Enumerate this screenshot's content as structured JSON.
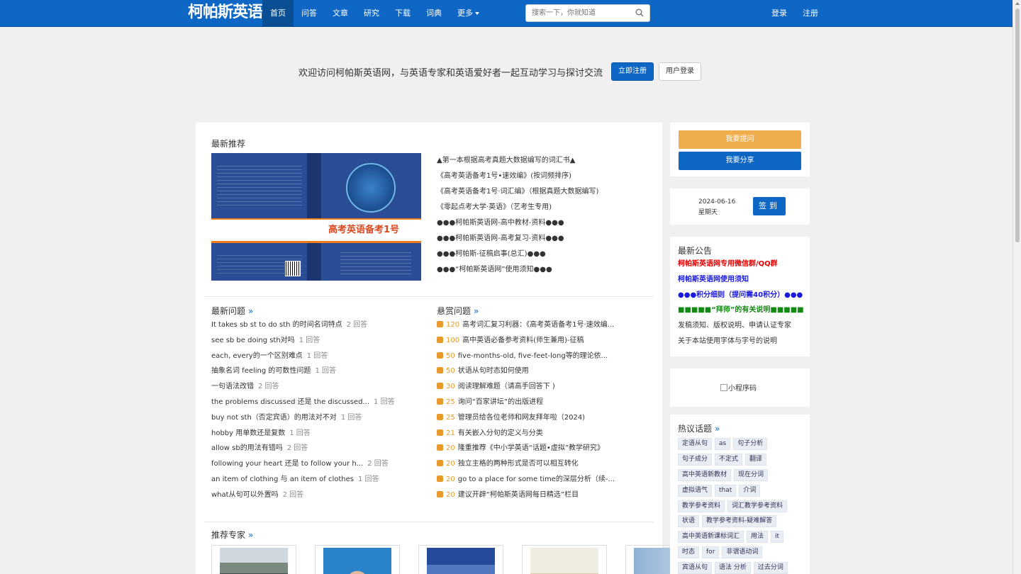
{
  "nav": {
    "brand": "柯帕斯英语网",
    "items": [
      "首页",
      "问答",
      "文章",
      "研究",
      "下载",
      "词典",
      "更多"
    ],
    "search_placeholder": "搜索一下，你就知道",
    "login": "登录",
    "register": "注册"
  },
  "welcome": {
    "text": "欢迎访问柯帕斯英语网，与英语专家和英语爱好者一起互动学习与探讨交流",
    "register_btn": "立即注册",
    "login_btn": "用户登录"
  },
  "recommend": {
    "title": "最新推荐",
    "book_title": "高考英语备考1号",
    "items": [
      "▲第一本根据高考真题大数据编写的词汇书▲",
      "《高考英语备考1号•速效编》(按词频排序)",
      "《高考英语备考1号·词汇编》（根据真题大数据编写)",
      "《零起点考大学·英语》（艺考生专用)",
      "●●●柯帕斯英语网-高中教材-资料●●●",
      "●●●柯帕斯英语网-高考复习-资料●●●",
      "●●●柯帕斯-征稿启事(总汇)●●●",
      "●●●“柯帕斯英语网”使用须知●●●"
    ]
  },
  "latest_questions": {
    "title": "最新问题",
    "more": "»",
    "items": [
      {
        "q": "It takes sb st to do sth 的时间名词特点",
        "a": "2 回答"
      },
      {
        "q": "see sb be doing sth对吗",
        "a": "1 回答"
      },
      {
        "q": "each, every的一个区别难点",
        "a": "1 回答"
      },
      {
        "q": "抽象名词 feeling 的可数性问题",
        "a": "1 回答"
      },
      {
        "q": "一句语法改错",
        "a": "2 回答"
      },
      {
        "q": "the problems discussed 还是 the discussed...",
        "a": "1 回答"
      },
      {
        "q": "buy not sth（否定宾语）的用法对不对",
        "a": "1 回答"
      },
      {
        "q": "hobby 用单数还是复数",
        "a": "1 回答"
      },
      {
        "q": "allow sb的用法有错吗",
        "a": "2 回答"
      },
      {
        "q": "following your heart 还是 to follow your h...",
        "a": "2 回答"
      },
      {
        "q": "an item of clothing 与 an item of clothes",
        "a": "1 回答"
      },
      {
        "q": "what从句可以外置吗",
        "a": "2 回答"
      }
    ]
  },
  "reward_questions": {
    "title": "悬赏问题",
    "more": "»",
    "items": [
      {
        "r": "120",
        "q": "高考词汇复习利器：《高考英语备考1号·速效编..."
      },
      {
        "r": "100",
        "q": "高中英语必备参考资料(师生兼用)-征稿"
      },
      {
        "r": "50",
        "q": "five-months-old, five-feet-long等的理论依..."
      },
      {
        "r": "50",
        "q": "状语从句时态如何使用"
      },
      {
        "r": "30",
        "q": "阅读理解难题（请高手回答下 )"
      },
      {
        "r": "25",
        "q": "询问“百家讲坛”的出版进程"
      },
      {
        "r": "25",
        "q": "管理员给各位老师和网友拜年啦（2024)"
      },
      {
        "r": "21",
        "q": "有关嵌入分句的定义与分类"
      },
      {
        "r": "20",
        "q": "隆重推荐《中小学英语“话题•虚拟”教学研究》"
      },
      {
        "r": "20",
        "q": "独立主格的两种形式是否可以相互转化"
      },
      {
        "r": "20",
        "q": "go to a place for some time的深层分析（续-..."
      },
      {
        "r": "20",
        "q": "建议开辟“柯帕斯英语网每日精选”栏目"
      }
    ]
  },
  "experts": {
    "title": "推荐专家",
    "more": "»"
  },
  "sidebar": {
    "ask_btn": "我要提问",
    "share_btn": "我要分享",
    "date": "2024-06-16",
    "weekday": "星期天",
    "sign_btn": "签到",
    "notice_title": "最新公告",
    "notices": [
      {
        "text": "柯帕斯英语网专用微信群/QQ群",
        "color": "#e00000"
      },
      {
        "text": "柯帕斯英语网使用须知",
        "color": "#1a1adc"
      },
      {
        "text": "●●●积分细则（提问需40积分）●●●",
        "color": "#1a1adc"
      },
      {
        "text": "■■■■■“拜师”的有关说明■■■■■",
        "color": "#138a13"
      },
      {
        "text": "发稿须知、版权说明、申请认证专家",
        "color": "#333333"
      },
      {
        "text": "关于本站使用字体与字号的说明",
        "color": "#333333"
      }
    ],
    "qr_alt": "小程序码",
    "hot_title": "热议话题",
    "hot_more": "»",
    "tag_rows": [
      [
        "定语从句",
        "as",
        "句子分析"
      ],
      [
        "句子成分",
        "不定式",
        "翻译"
      ],
      [
        "高中英语新教材",
        "现在分词"
      ],
      [
        "虚拟语气",
        "that",
        "介词"
      ],
      [
        "教学参考资料",
        "词汇教学参考资料"
      ],
      [
        "状语",
        "教学参考资料-疑难解答"
      ],
      [
        "高中英语新课标词汇",
        "用法",
        "it"
      ],
      [
        "时态",
        "for",
        "非谓语动词"
      ],
      [
        "宾语从句",
        "语法 分析",
        "过去分词"
      ]
    ]
  },
  "colors": {
    "primary": "#0e66c5",
    "orange": "#f0ad4e",
    "reward": "#e89b2a"
  }
}
